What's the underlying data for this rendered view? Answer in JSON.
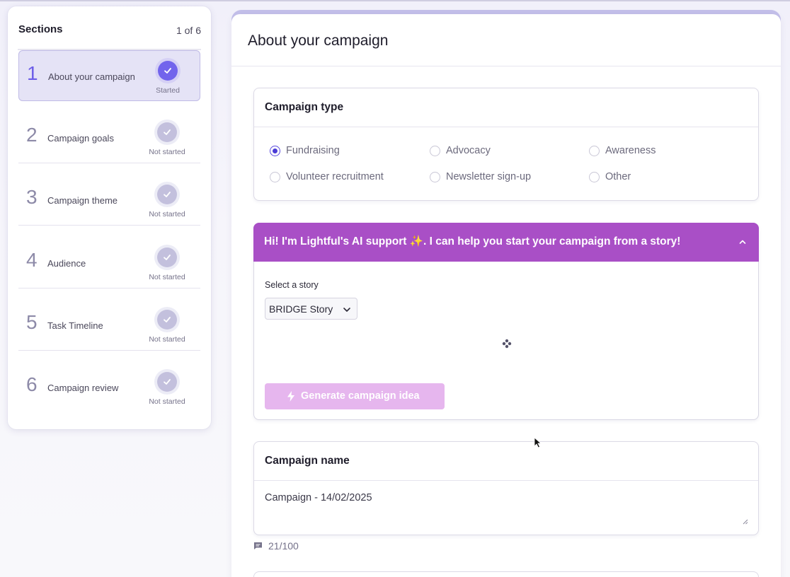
{
  "sidebar": {
    "title": "Sections",
    "count": "1 of 6",
    "items": [
      {
        "num": "1",
        "label": "About your campaign",
        "status": "Started",
        "active": true
      },
      {
        "num": "2",
        "label": "Campaign goals",
        "status": "Not started",
        "active": false
      },
      {
        "num": "3",
        "label": "Campaign theme",
        "status": "Not started",
        "active": false
      },
      {
        "num": "4",
        "label": "Audience",
        "status": "Not started",
        "active": false
      },
      {
        "num": "5",
        "label": "Task Timeline",
        "status": "Not started",
        "active": false
      },
      {
        "num": "6",
        "label": "Campaign review",
        "status": "Not started",
        "active": false
      }
    ]
  },
  "main": {
    "title": "About your campaign",
    "campaign_type": {
      "title": "Campaign type",
      "options": [
        {
          "label": "Fundraising",
          "selected": true
        },
        {
          "label": "Advocacy",
          "selected": false
        },
        {
          "label": "Awareness",
          "selected": false
        },
        {
          "label": "Volunteer recruitment",
          "selected": false
        },
        {
          "label": "Newsletter sign-up",
          "selected": false
        },
        {
          "label": "Other",
          "selected": false
        }
      ]
    },
    "ai_support": {
      "banner": "Hi! I'm Lightful's AI support ✨. I can help you start your campaign from a story!",
      "select_label": "Select a story",
      "select_value": "BRIDGE Story",
      "generate_label": "Generate campaign idea"
    },
    "campaign_name": {
      "title": "Campaign name",
      "value": "Campaign - 14/02/2025",
      "counter": "21/100"
    }
  },
  "colors": {
    "accent": "#6d5ee8",
    "ai_banner": "#a94fc6",
    "generate_button": "#e6b6ee"
  },
  "icons": {
    "step_check": "check-icon",
    "collapse": "chevron-up-icon",
    "select": "chevron-down-icon",
    "generate": "bolt-icon",
    "loading": "spinner-icon",
    "counter": "comment-icon"
  }
}
